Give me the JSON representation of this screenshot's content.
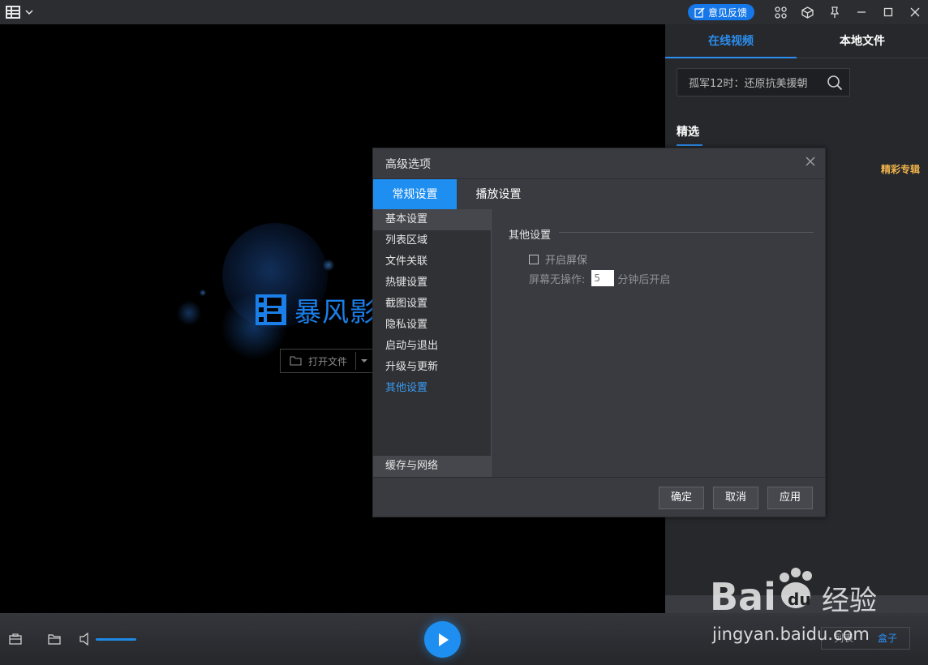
{
  "titlebar": {
    "feedback_label": "意见反馈"
  },
  "video": {
    "logo_text": "暴风影",
    "open_file_label": "打开文件"
  },
  "right_panel": {
    "tabs": [
      {
        "label": "在线视频",
        "active": true
      },
      {
        "label": "本地文件",
        "active": false
      }
    ],
    "search_value": "孤军12时：还原抗美援朝",
    "section_title": "精选",
    "special_label": "精彩专辑"
  },
  "dialog": {
    "title": "高级选项",
    "tabs": [
      {
        "label": "常规设置",
        "active": true
      },
      {
        "label": "播放设置",
        "active": false
      }
    ],
    "sidebar": [
      "基本设置",
      "列表区域",
      "文件关联",
      "热键设置",
      "截图设置",
      "隐私设置",
      "启动与退出",
      "升级与更新",
      "其他设置"
    ],
    "sidebar_bottom": "缓存与网络",
    "group_title": "其他设置",
    "screensaver_label": "开启屏保",
    "screensaver_checked": false,
    "idle_label": "屏幕无操作:",
    "idle_value": "5",
    "idle_suffix": "分钟后开启",
    "buttons": {
      "ok": "确定",
      "cancel": "取消",
      "apply": "应用"
    }
  },
  "bottombar": {
    "segments": [
      {
        "label": "列表",
        "active": false
      },
      {
        "label": "盒子",
        "active": true
      }
    ]
  },
  "watermark": {
    "url": "jingyan.baidu.com",
    "logo_text": "Bai du 经验"
  },
  "colors": {
    "accent": "#1f8ef1",
    "special": "#f0b44b",
    "logo": "#1a7fe8"
  }
}
